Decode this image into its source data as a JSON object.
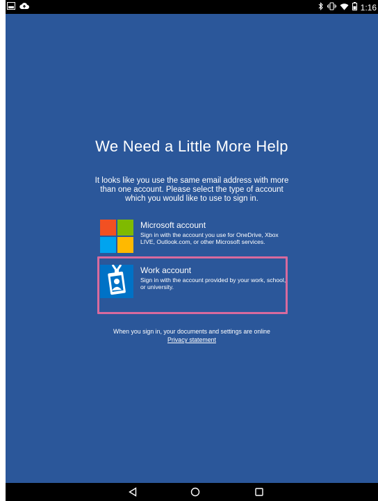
{
  "status_bar": {
    "left_icons": [
      "image-notification-icon",
      "cloud-upload-icon"
    ],
    "right_icons": [
      "bluetooth-icon",
      "vibrate-icon",
      "wifi-icon",
      "battery-icon"
    ],
    "time": "1:16"
  },
  "page": {
    "title": "We Need a Little More Help",
    "intro": "It looks like you use the same email address with more than one account. Please select the type of account which you would like to use to sign in."
  },
  "accounts": [
    {
      "title": "Microsoft account",
      "description": "Sign in with the account you use for OneDrive, Xbox LIVE, Outlook.com, or other Microsoft services.",
      "icon": "microsoft-logo-icon"
    },
    {
      "title": "Work account",
      "description": "Sign in with the account provided by your work, school, or university.",
      "icon": "work-badge-icon"
    }
  ],
  "footer": {
    "text": "When you sign in, your documents and settings are online",
    "privacy_link": "Privacy statement"
  },
  "nav_bar": {
    "buttons": [
      "back-icon",
      "home-icon",
      "recents-icon"
    ]
  },
  "colors": {
    "background": "#2b579a",
    "highlight": "#d86a9e",
    "ms_red": "#f25022",
    "ms_green": "#7fba00",
    "ms_blue": "#00a4ef",
    "ms_yellow": "#ffb900",
    "work_blue": "#0072c6"
  }
}
